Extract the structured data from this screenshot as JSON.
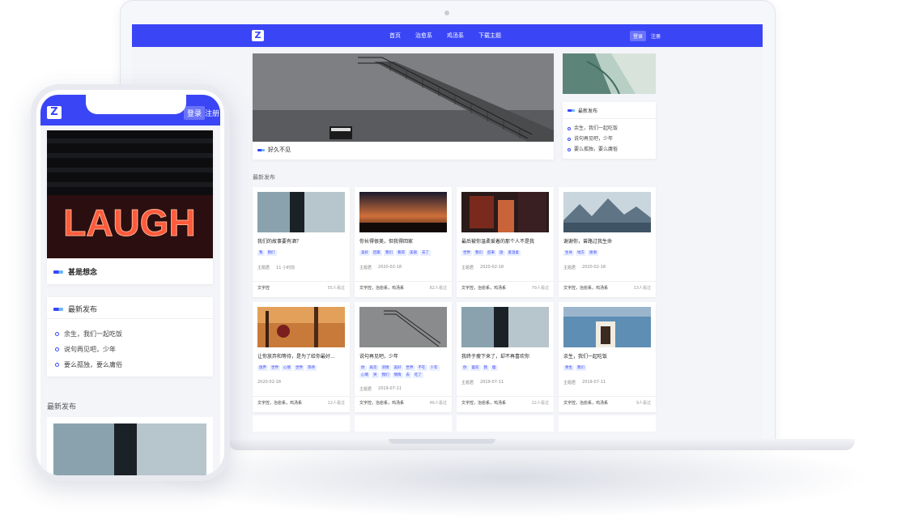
{
  "laptop": {
    "brand_logo": "Z",
    "nav": [
      "首页",
      "治愈系",
      "鸡汤系",
      "下载主题"
    ],
    "login": "登录",
    "register": "注册",
    "hero_caption": "好久不见",
    "sidebar": {
      "title": "最新发布",
      "items": [
        "余生，我们一起吃饭",
        "说句再见吧，少年",
        "要么孤独，要么庸俗"
      ]
    },
    "latest_title": "最新发布",
    "cards": [
      {
        "title": "我们的故事要有酒？",
        "tags": [
          "我",
          "我们"
        ],
        "author": "主题君",
        "date": "11 小时前",
        "category": "文字控",
        "views": "55人看过"
      },
      {
        "title": "你长得很美，但我得回家",
        "tags": [
          "美好",
          "回家",
          "我们",
          "看得",
          "美丽",
          "去了"
        ],
        "author": "主题君",
        "date": "2020-02-18",
        "category": "文字控，治愈系，鸡汤系",
        "views": "82人看过"
      },
      {
        "title": "最后被你温柔爱着的那个人不是我",
        "tags": [
          "世界",
          "我们",
          "后来",
          "放",
          "爱温柔"
        ],
        "author": "主题君",
        "date": "2020-02-18",
        "category": "文字控，治愈系，鸡汤系",
        "views": "79人看过"
      },
      {
        "title": "谢谢你，曾路过我生命",
        "tags": [
          "生命",
          "地方",
          "谢谢"
        ],
        "author": "主题君",
        "date": "2020-02-18",
        "category": "文字控，治愈系，鸡汤系",
        "views": "13人看过"
      },
      {
        "title": "让你放弃和等待，是为了给你最好...",
        "tags": [
          "放弃",
          "世界",
          "心情",
          "世界",
          "等待"
        ],
        "author": "",
        "date": "2020-02-18",
        "category": "文字控，治愈系，鸡汤系",
        "views": "12人看过"
      },
      {
        "title": "说句再见吧，少年",
        "tags": [
          "你",
          "再见",
          "浓情",
          "美好",
          "世界",
          "不在",
          "少年",
          "心情",
          "哭",
          "我们",
          "情情",
          "去",
          "吃了"
        ],
        "author": "主题君",
        "date": "2019-07-11",
        "category": "文字控，治愈系，鸡汤系",
        "views": "46人看过"
      },
      {
        "title": "我终于瘦下来了，却不再喜欢你",
        "tags": [
          "你",
          "喜欢",
          "我",
          "瘦"
        ],
        "author": "主题君",
        "date": "2019-07-11",
        "category": "文字控，治愈系，鸡汤系",
        "views": "22人看过"
      },
      {
        "title": "余生，我们一起吃饭",
        "tags": [
          "余生",
          "我们"
        ],
        "author": "主题君",
        "date": "2019-07-11",
        "category": "文字控，治愈系，鸡汤系",
        "views": "9人看过"
      }
    ]
  },
  "phone": {
    "brand_logo": "Z",
    "login": "登录",
    "register": "注册",
    "hero_neon": "LAUGH",
    "hero_caption": "甚是想念",
    "box": {
      "title": "最新发布",
      "items": [
        "余生，我们一起吃饭",
        "说句再见吧，少年",
        "要么孤独，要么庸俗"
      ]
    },
    "latest_title": "最新发布"
  }
}
